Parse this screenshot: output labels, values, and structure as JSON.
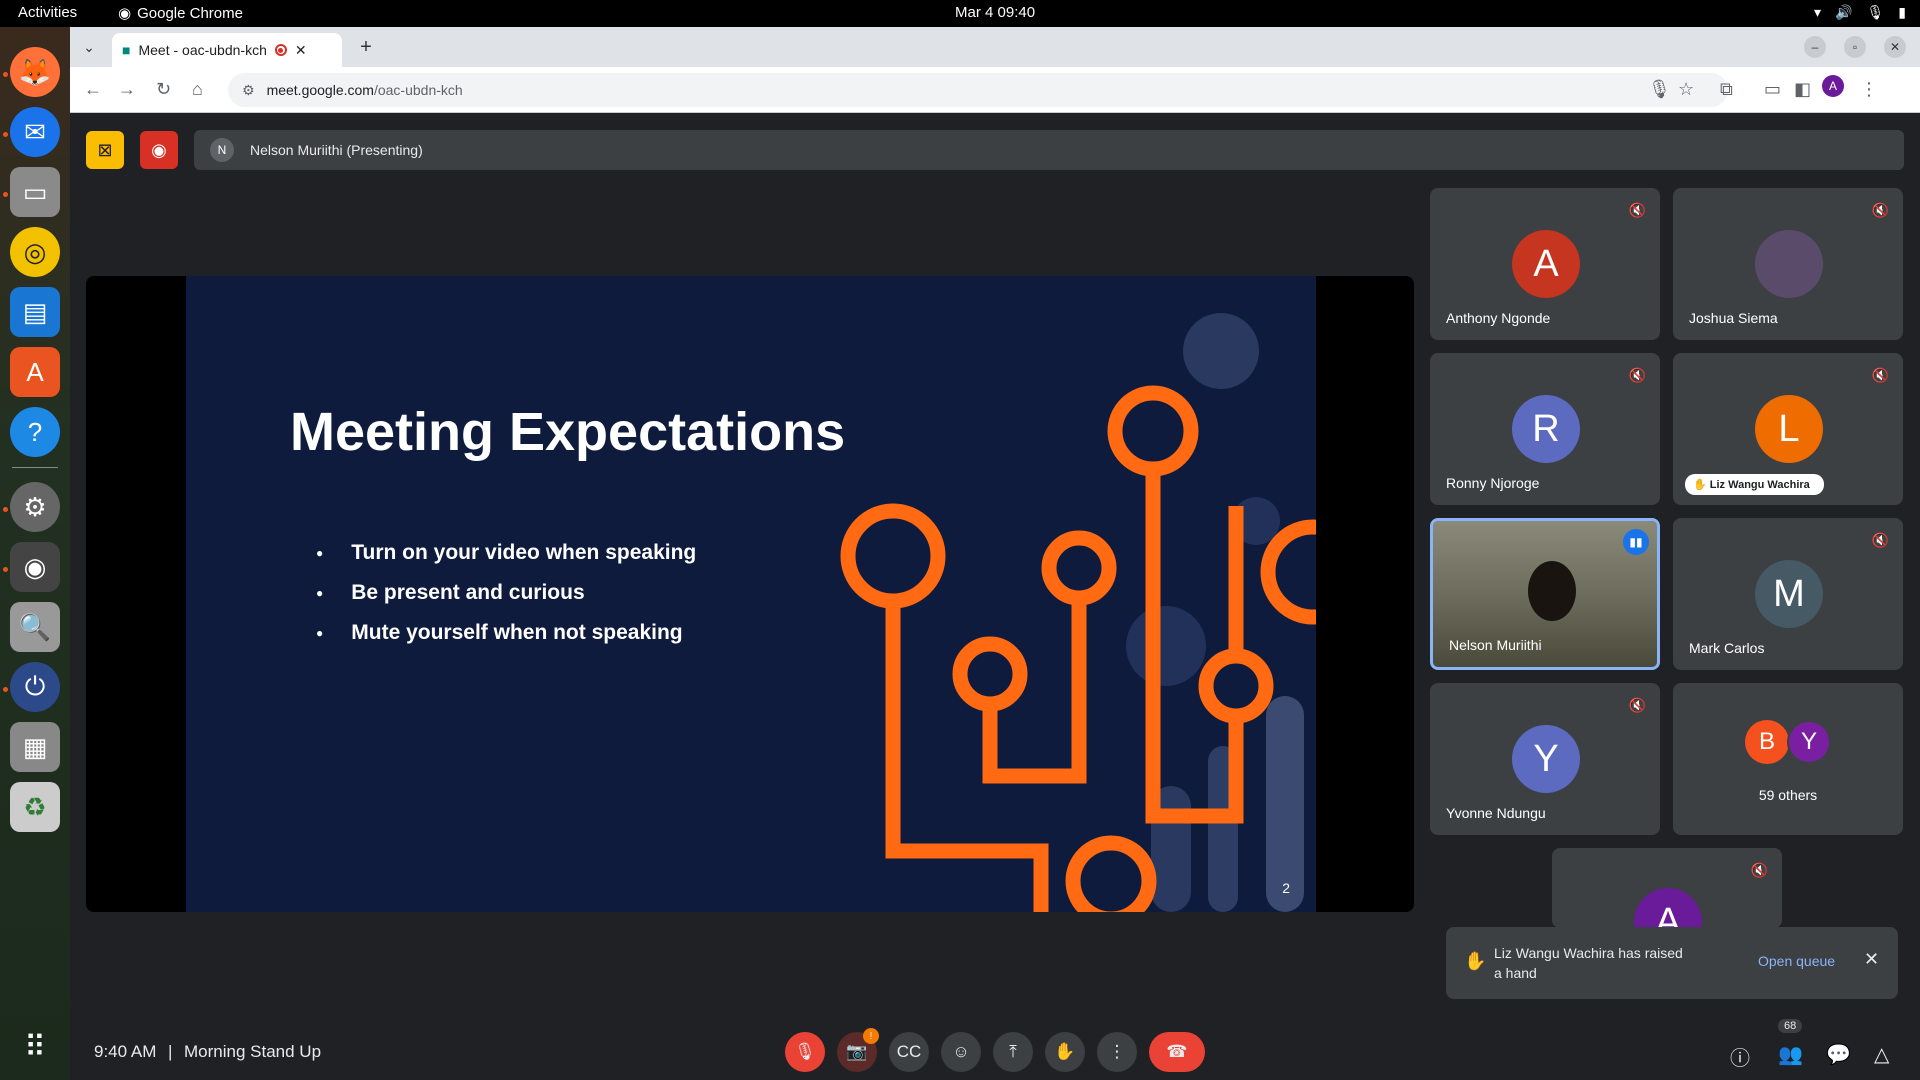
{
  "os": {
    "activities": "Activities",
    "app_name": "Google Chrome",
    "datetime": "Mar 4  09:40"
  },
  "browser": {
    "tab_title": "Meet - oac-ubdn-kch",
    "url_domain": "meet.google.com",
    "url_path": "/oac-ubdn-kch",
    "profile_initial": "A"
  },
  "meet": {
    "presenter_initial": "N",
    "presenter_label": "Nelson Muriithi (Presenting)",
    "slide": {
      "title": "Meeting Expectations",
      "bullets": [
        "Turn on your video when speaking",
        "Be present and curious",
        "Mute yourself when not speaking"
      ],
      "page": "2"
    },
    "participants": [
      {
        "initial": "A",
        "name": "Anthony Ngonde",
        "color": "#c5351f"
      },
      {
        "initial": "",
        "name": "Joshua Siema",
        "color": "#5b4b6b"
      },
      {
        "initial": "R",
        "name": "Ronny Njoroge",
        "color": "#5c6bc0"
      },
      {
        "initial": "L",
        "name": "Liz Wangu Wachira",
        "color": "#ef6c00"
      },
      {
        "initial": "",
        "name": "Nelson Muriithi",
        "color": "#6b6a5a"
      },
      {
        "initial": "M",
        "name": "Mark Carlos",
        "color": "#455a64"
      },
      {
        "initial": "Y",
        "name": "Yvonne Ndungu",
        "color": "#5c6bc0"
      },
      {
        "initial": "A",
        "name": "",
        "color": "#6a1b9a"
      }
    ],
    "others": {
      "initials": [
        "B",
        "Y"
      ],
      "label": "59 others"
    },
    "toast": {
      "message": "Liz Wangu Wachira has raised a hand",
      "action": "Open queue"
    },
    "footer": {
      "time": "9:40 AM",
      "separator": "|",
      "meeting_name": "Morning Stand Up",
      "people_count": "68"
    }
  }
}
